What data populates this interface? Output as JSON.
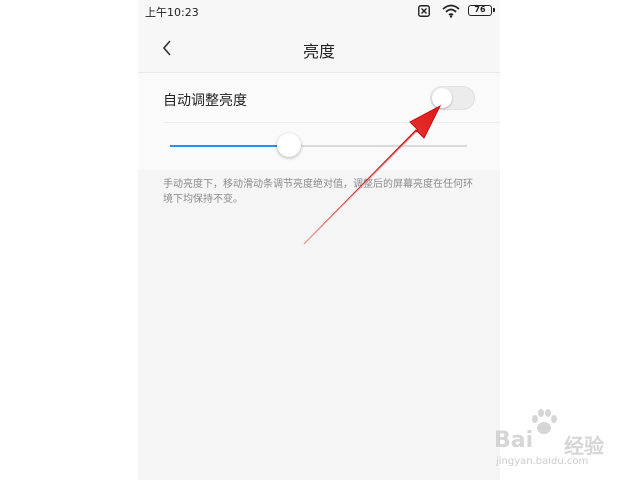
{
  "status_bar": {
    "time": "上午10:23",
    "battery": "76"
  },
  "nav": {
    "title": "亮度"
  },
  "auto_brightness": {
    "label": "自动调整亮度",
    "enabled": false
  },
  "brightness_slider": {
    "value": 0.4
  },
  "description": "手动亮度下，移动滑动条调节亮度绝对值，调整后的屏幕亮度在任何环境下均保持不变。",
  "watermark": {
    "brand": "Bai",
    "brand_cn": "经验",
    "url": "jingyan.baidu.com"
  },
  "colors": {
    "accent": "#2d8fe8",
    "annotation_arrow": "#e02020"
  },
  "icons": [
    "chevron-left-icon",
    "notification-off-icon",
    "wifi-icon",
    "battery-icon",
    "paw-icon"
  ]
}
